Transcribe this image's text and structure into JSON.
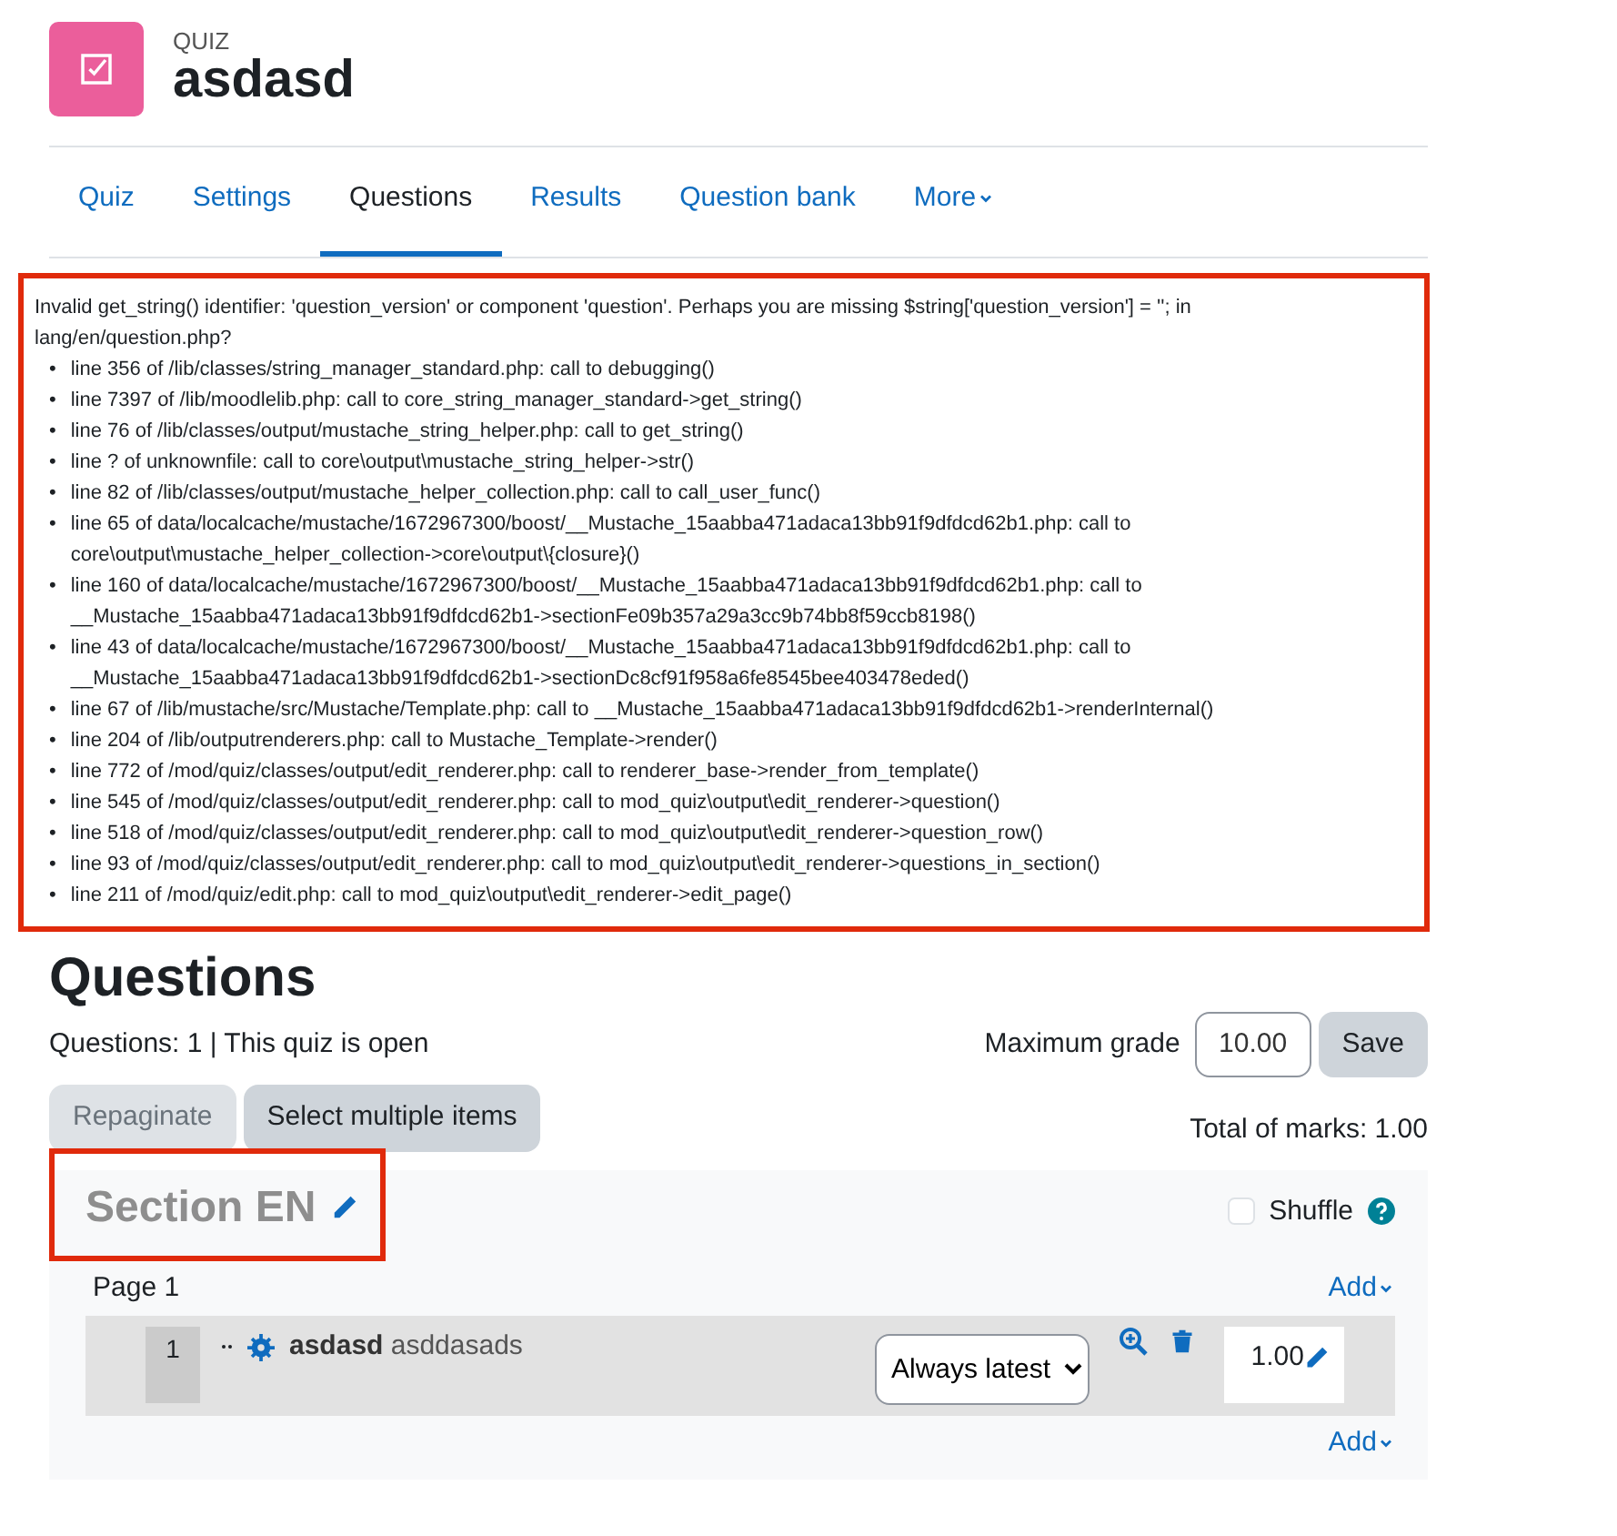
{
  "header": {
    "label": "QUIZ",
    "title": "asdasd"
  },
  "tabs": [
    {
      "label": "Quiz",
      "selected": false
    },
    {
      "label": "Settings",
      "selected": false
    },
    {
      "label": "Questions",
      "selected": true
    },
    {
      "label": "Results",
      "selected": false
    },
    {
      "label": "Question bank",
      "selected": false
    },
    {
      "label": "More",
      "selected": false,
      "kind": "dropdown"
    }
  ],
  "debug": {
    "message": "Invalid get_string() identifier: 'question_version' or component 'question'. Perhaps you are missing $string['question_version'] = ''; in lang/en/question.php?",
    "bullet": "•",
    "trace": [
      "line 356 of /lib/classes/string_manager_standard.php: call to debugging()",
      "line 7397 of /lib/moodlelib.php: call to core_string_manager_standard->get_string()",
      "line 76 of /lib/classes/output/mustache_string_helper.php: call to get_string()",
      "line ? of unknownfile: call to core\\output\\mustache_string_helper->str()",
      "line 82 of /lib/classes/output/mustache_helper_collection.php: call to call_user_func()",
      "line 65 of data/localcache/mustache/1672967300/boost/__Mustache_15aabba471adaca13bb91f9dfdcd62b1.php: call to core\\output\\mustache_helper_collection->core\\output\\{closure}()",
      "line 160 of data/localcache/mustache/1672967300/boost/__Mustache_15aabba471adaca13bb91f9dfdcd62b1.php: call to __Mustache_15aabba471adaca13bb91f9dfdcd62b1->sectionFe09b357a29a3cc9b74bb8f59ccb8198()",
      "line 43 of data/localcache/mustache/1672967300/boost/__Mustache_15aabba471adaca13bb91f9dfdcd62b1.php: call to __Mustache_15aabba471adaca13bb91f9dfdcd62b1->sectionDc8cf91f958a6fe8545bee403478eded()",
      "line 67 of /lib/mustache/src/Mustache/Template.php: call to __Mustache_15aabba471adaca13bb91f9dfdcd62b1->renderInternal()",
      "line 204 of /lib/outputrenderers.php: call to Mustache_Template->render()",
      "line 772 of /mod/quiz/classes/output/edit_renderer.php: call to renderer_base->render_from_template()",
      "line 545 of /mod/quiz/classes/output/edit_renderer.php: call to mod_quiz\\output\\edit_renderer->question()",
      "line 518 of /mod/quiz/classes/output/edit_renderer.php: call to mod_quiz\\output\\edit_renderer->question_row()",
      "line 93 of /mod/quiz/classes/output/edit_renderer.php: call to mod_quiz\\output\\edit_renderer->questions_in_section()",
      "line 211 of /mod/quiz/edit.php: call to mod_quiz\\output\\edit_renderer->edit_page()"
    ]
  },
  "heading": "Questions",
  "summary": "Questions: 1 | This quiz is open",
  "max_grade": {
    "label": "Maximum grade",
    "value": "10.00",
    "button": "Save"
  },
  "actions": [
    {
      "label": "Repaginate",
      "disabled": true
    },
    {
      "label": "Select multiple items",
      "disabled": false
    }
  ],
  "total_marks": "Total of marks: 1.00",
  "section": {
    "title": "Section EN",
    "shuffle": {
      "label": "Shuffle",
      "checked": false
    },
    "page": "Page 1",
    "add": "Add",
    "questions": [
      {
        "number": "1",
        "name": "asdasd",
        "text": "asddasads",
        "version": "Always latest",
        "mark": "1.00"
      }
    ],
    "add_bottom": "Add"
  }
}
